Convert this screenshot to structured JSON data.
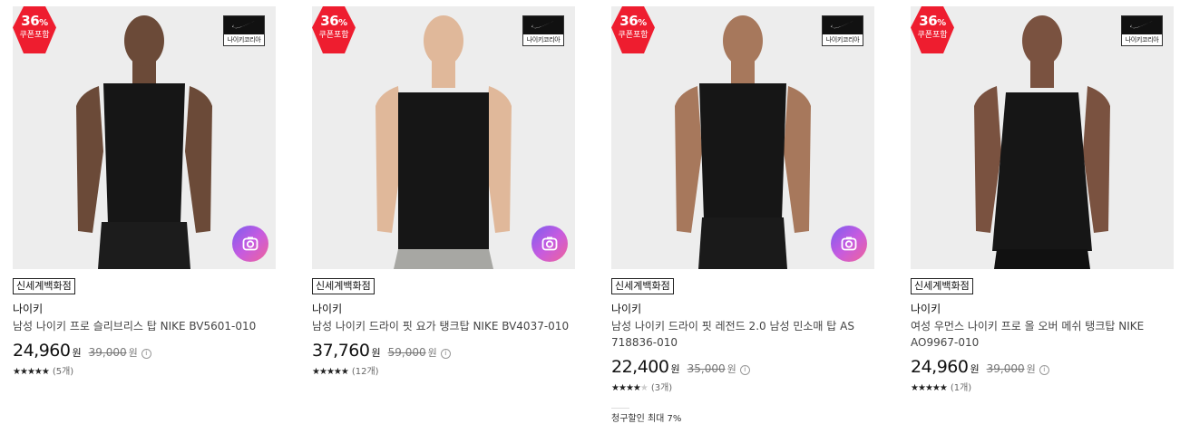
{
  "products": [
    {
      "discount_pct": "36",
      "discount_unit": "%",
      "coupon_label": "쿠폰포함",
      "logo_text": "나이키코리아",
      "store": "신세계백화점",
      "brand": "나이키",
      "name": "남성 나이키 프로 슬리브리스 탑 NIKE BV5601-010",
      "price": "24,960",
      "price_unit": "원",
      "original_price": "39,000",
      "original_unit": "원",
      "rating_stars": 5,
      "review_count": "(5개)",
      "has_camera": true
    },
    {
      "discount_pct": "36",
      "discount_unit": "%",
      "coupon_label": "쿠폰포함",
      "logo_text": "나이키코리아",
      "store": "신세계백화점",
      "brand": "나이키",
      "name": "남성 나이키 드라이 핏 요가 탱크탑 NIKE BV4037-010",
      "price": "37,760",
      "price_unit": "원",
      "original_price": "59,000",
      "original_unit": "원",
      "rating_stars": 5,
      "review_count": "(12개)",
      "has_camera": true
    },
    {
      "discount_pct": "36",
      "discount_unit": "%",
      "coupon_label": "쿠폰포함",
      "logo_text": "나이키코리아",
      "store": "신세계백화점",
      "brand": "나이키",
      "name": "남성 나이키 드라이 핏 레전드 2.0 남성 민소매 탑 AS 718836-010",
      "price": "22,400",
      "price_unit": "원",
      "original_price": "35,000",
      "original_unit": "원",
      "rating_stars": 4,
      "review_count": "(3개)",
      "has_camera": true,
      "promo": "청구할인 최대 7%"
    },
    {
      "discount_pct": "36",
      "discount_unit": "%",
      "coupon_label": "쿠폰포함",
      "logo_text": "나이키코리아",
      "store": "신세계백화점",
      "brand": "나이키",
      "name": "여성 우먼스 나이키 프로 올 오버 메쉬 탱크탑 NIKE AO9967-010",
      "price": "24,960",
      "price_unit": "원",
      "original_price": "39,000",
      "original_unit": "원",
      "rating_stars": 5,
      "review_count": "(1개)",
      "has_camera": false
    }
  ],
  "icons": {
    "camera": "camera-search-icon",
    "info": "info-icon",
    "star": "star-icon",
    "swoosh": "swoosh-logo"
  },
  "colors": {
    "badge": "#ee1d2f",
    "photo_bg": "#ededed",
    "camera_grad_start": "#7b5cf0",
    "camera_grad_end": "#f0639a"
  }
}
